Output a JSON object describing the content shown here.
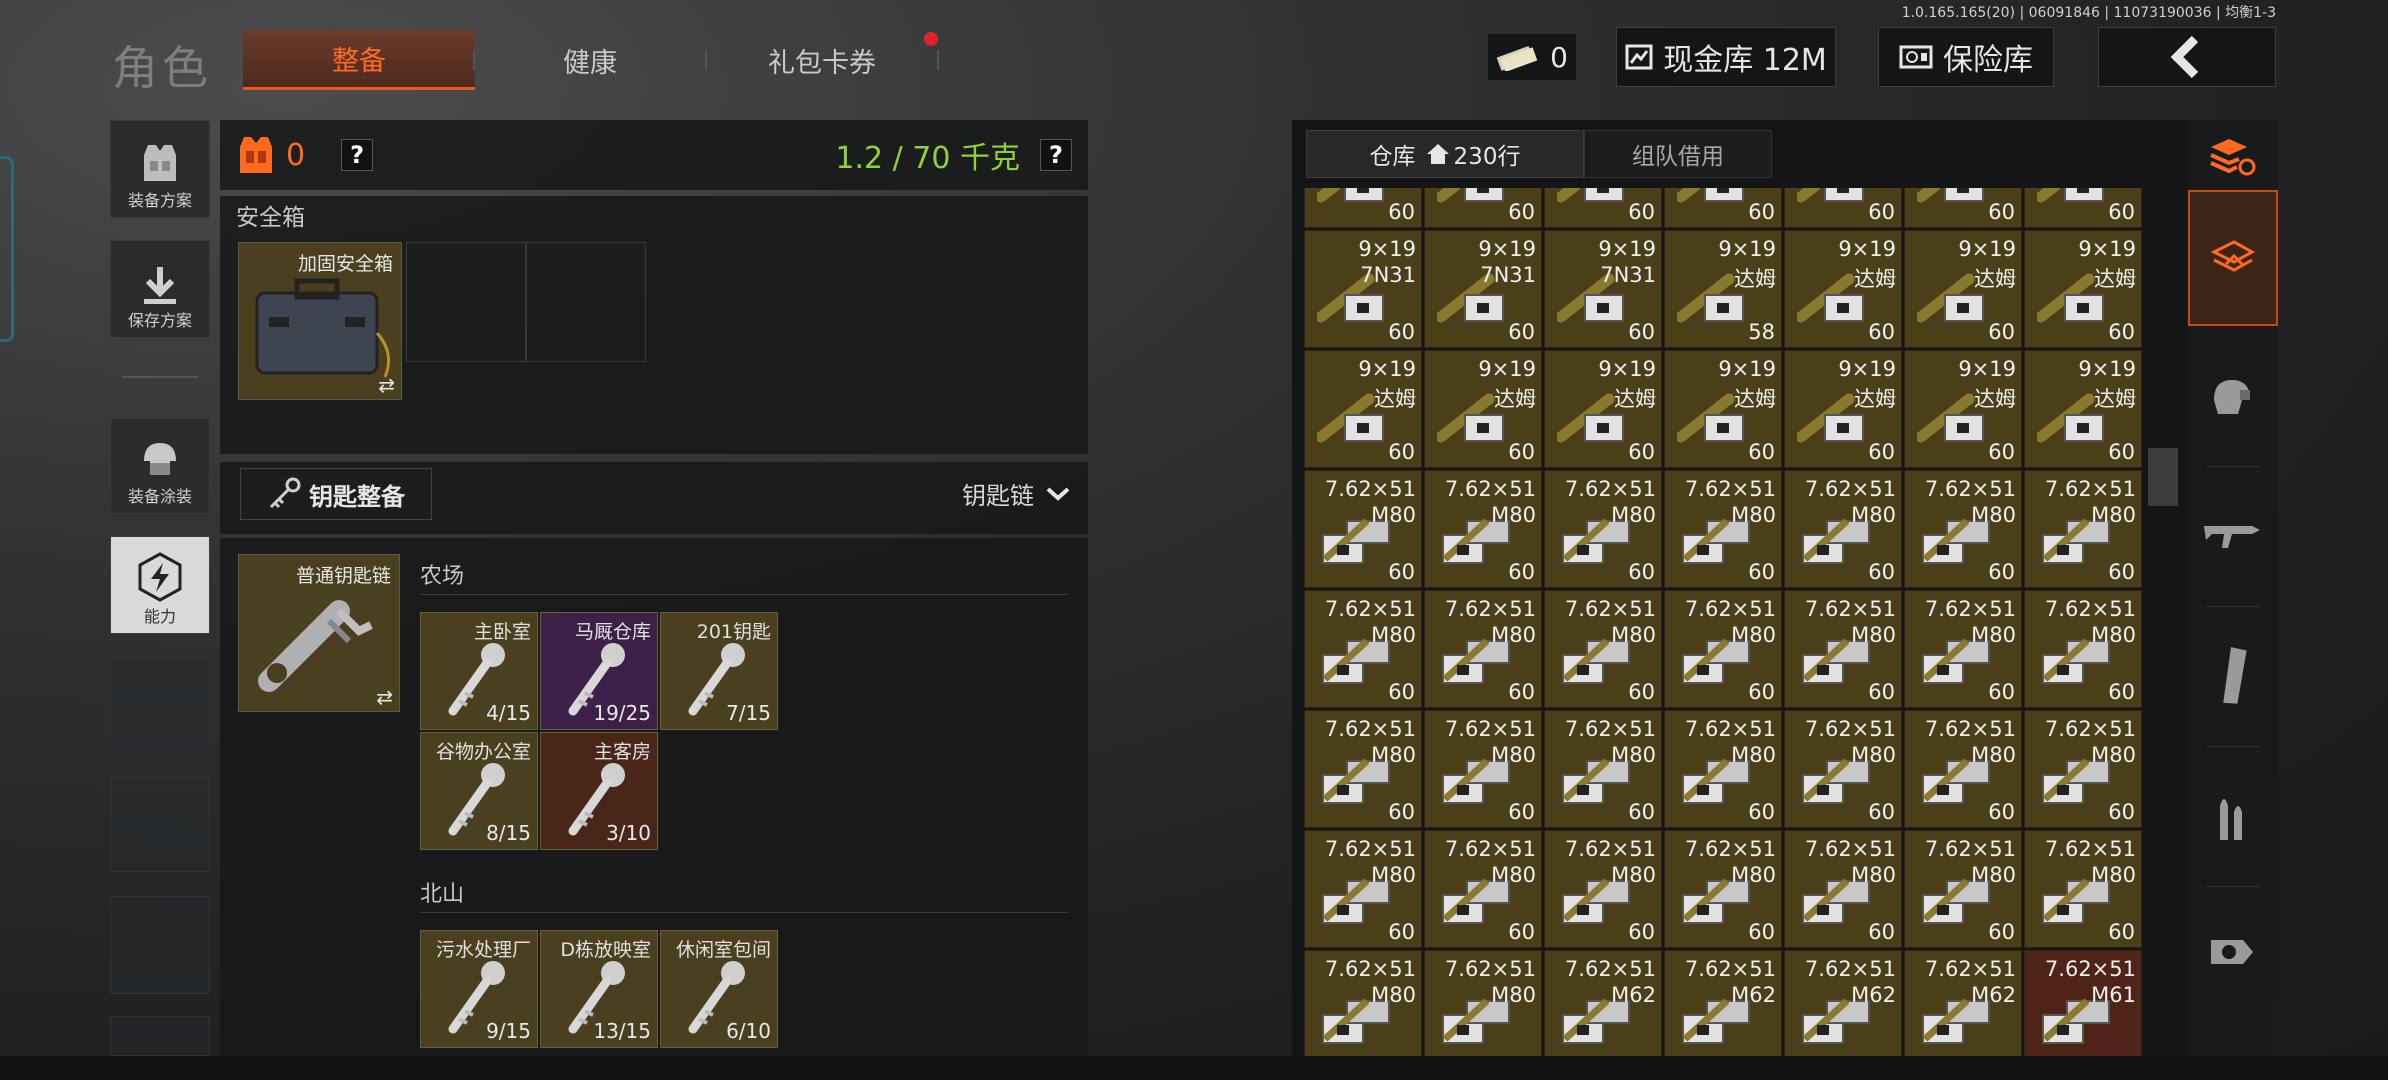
{
  "header": {
    "title": "角色",
    "tabs": [
      {
        "label": "整备",
        "active": true
      },
      {
        "label": "健康"
      },
      {
        "label": "礼包卡券",
        "has_notification": true
      }
    ],
    "version": "1.0.165.165(20) | 06091846 | 11073190036 | 均衡1-3",
    "currency_count": "0",
    "cash_vault_label": "现金库 12M",
    "insurance_label": "保险库"
  },
  "left_nav": [
    {
      "label": "装备方案",
      "icon": "vest-icon"
    },
    {
      "label": "保存方案",
      "icon": "download-icon"
    },
    {
      "label": "装备涂装",
      "icon": "helmet-icon"
    },
    {
      "label": "能力",
      "icon": "lightning-icon",
      "active": true
    }
  ],
  "equipment": {
    "armor_count": "0",
    "help": "?",
    "weight": "1.2 / 70 千克",
    "safe_box_title": "安全箱",
    "safe_box_item": "加固安全箱",
    "key_section_button": "钥匙整备",
    "key_dropdown": "钥匙链",
    "keychain_item": "普通钥匙链",
    "swap_icon": "⇄",
    "groups": [
      {
        "name": "农场",
        "keys": [
          {
            "name": "主卧室",
            "count": "4/15",
            "bg": "#4a4020"
          },
          {
            "name": "马厩仓库",
            "count": "19/25",
            "bg": "#3c2048"
          },
          {
            "name": "201钥匙",
            "count": "7/15",
            "bg": "#4a4020"
          },
          {
            "name": "谷物办公室",
            "count": "8/15",
            "bg": "#4a4020"
          },
          {
            "name": "主客房",
            "count": "3/10",
            "bg": "#4a2618"
          }
        ]
      },
      {
        "name": "北山",
        "keys": [
          {
            "name": "污水处理厂",
            "count": "9/15",
            "bg": "#4a4020"
          },
          {
            "name": "D栋放映室",
            "count": "13/15",
            "bg": "#4a4020"
          },
          {
            "name": "休闲室包间",
            "count": "6/10",
            "bg": "#4a4020"
          }
        ]
      }
    ]
  },
  "warehouse": {
    "tab_label": "仓库",
    "rows_label": "230行",
    "team_tab": "组队借用",
    "rows": [
      [
        {
          "t1": "",
          "t2": "",
          "c": "60"
        },
        {
          "t1": "",
          "t2": "",
          "c": "60"
        },
        {
          "t1": "",
          "t2": "",
          "c": "60"
        },
        {
          "t1": "",
          "t2": "",
          "c": "60"
        },
        {
          "t1": "",
          "t2": "",
          "c": "60"
        },
        {
          "t1": "",
          "t2": "",
          "c": "60"
        },
        {
          "t1": "",
          "t2": "",
          "c": "60"
        }
      ],
      [
        {
          "t1": "9×19",
          "t2": "7N31",
          "c": "60"
        },
        {
          "t1": "9×19",
          "t2": "7N31",
          "c": "60"
        },
        {
          "t1": "9×19",
          "t2": "7N31",
          "c": "60"
        },
        {
          "t1": "9×19",
          "t2": "达姆",
          "c": "58"
        },
        {
          "t1": "9×19",
          "t2": "达姆",
          "c": "60"
        },
        {
          "t1": "9×19",
          "t2": "达姆",
          "c": "60"
        },
        {
          "t1": "9×19",
          "t2": "达姆",
          "c": "60"
        }
      ],
      [
        {
          "t1": "9×19",
          "t2": "达姆",
          "c": "60"
        },
        {
          "t1": "9×19",
          "t2": "达姆",
          "c": "60"
        },
        {
          "t1": "9×19",
          "t2": "达姆",
          "c": "60"
        },
        {
          "t1": "9×19",
          "t2": "达姆",
          "c": "60"
        },
        {
          "t1": "9×19",
          "t2": "达姆",
          "c": "60"
        },
        {
          "t1": "9×19",
          "t2": "达姆",
          "c": "60"
        },
        {
          "t1": "9×19",
          "t2": "达姆",
          "c": "60"
        }
      ],
      [
        {
          "t1": "7.62×51",
          "t2": "M80",
          "c": "60"
        },
        {
          "t1": "7.62×51",
          "t2": "M80",
          "c": "60"
        },
        {
          "t1": "7.62×51",
          "t2": "M80",
          "c": "60"
        },
        {
          "t1": "7.62×51",
          "t2": "M80",
          "c": "60"
        },
        {
          "t1": "7.62×51",
          "t2": "M80",
          "c": "60"
        },
        {
          "t1": "7.62×51",
          "t2": "M80",
          "c": "60"
        },
        {
          "t1": "7.62×51",
          "t2": "M80",
          "c": "60"
        }
      ],
      [
        {
          "t1": "7.62×51",
          "t2": "M80",
          "c": "60"
        },
        {
          "t1": "7.62×51",
          "t2": "M80",
          "c": "60"
        },
        {
          "t1": "7.62×51",
          "t2": "M80",
          "c": "60"
        },
        {
          "t1": "7.62×51",
          "t2": "M80",
          "c": "60"
        },
        {
          "t1": "7.62×51",
          "t2": "M80",
          "c": "60"
        },
        {
          "t1": "7.62×51",
          "t2": "M80",
          "c": "60"
        },
        {
          "t1": "7.62×51",
          "t2": "M80",
          "c": "60"
        }
      ],
      [
        {
          "t1": "7.62×51",
          "t2": "M80",
          "c": "60"
        },
        {
          "t1": "7.62×51",
          "t2": "M80",
          "c": "60"
        },
        {
          "t1": "7.62×51",
          "t2": "M80",
          "c": "60"
        },
        {
          "t1": "7.62×51",
          "t2": "M80",
          "c": "60"
        },
        {
          "t1": "7.62×51",
          "t2": "M80",
          "c": "60"
        },
        {
          "t1": "7.62×51",
          "t2": "M80",
          "c": "60"
        },
        {
          "t1": "7.62×51",
          "t2": "M80",
          "c": "60"
        }
      ],
      [
        {
          "t1": "7.62×51",
          "t2": "M80",
          "c": "60"
        },
        {
          "t1": "7.62×51",
          "t2": "M80",
          "c": "60"
        },
        {
          "t1": "7.62×51",
          "t2": "M80",
          "c": "60"
        },
        {
          "t1": "7.62×51",
          "t2": "M80",
          "c": "60"
        },
        {
          "t1": "7.62×51",
          "t2": "M80",
          "c": "60"
        },
        {
          "t1": "7.62×51",
          "t2": "M80",
          "c": "60"
        },
        {
          "t1": "7.62×51",
          "t2": "M80",
          "c": "60"
        }
      ],
      [
        {
          "t1": "7.62×51",
          "t2": "M80",
          "c": ""
        },
        {
          "t1": "7.62×51",
          "t2": "M80",
          "c": ""
        },
        {
          "t1": "7.62×51",
          "t2": "M62",
          "c": ""
        },
        {
          "t1": "7.62×51",
          "t2": "M62",
          "c": ""
        },
        {
          "t1": "7.62×51",
          "t2": "M62",
          "c": ""
        },
        {
          "t1": "7.62×51",
          "t2": "M62",
          "c": ""
        },
        {
          "t1": "7.62×51",
          "t2": "M61",
          "c": "",
          "red": true
        }
      ]
    ]
  },
  "side_nav": [
    "sort-icon",
    "backpack-icon",
    "helmet-icon",
    "rifle-icon",
    "magazine-icon",
    "ammo-icon",
    "scope-icon"
  ],
  "colors": {
    "accent": "#ff6a1e",
    "weight": "#8fd13a",
    "cell_bg": "#4a3f18"
  }
}
